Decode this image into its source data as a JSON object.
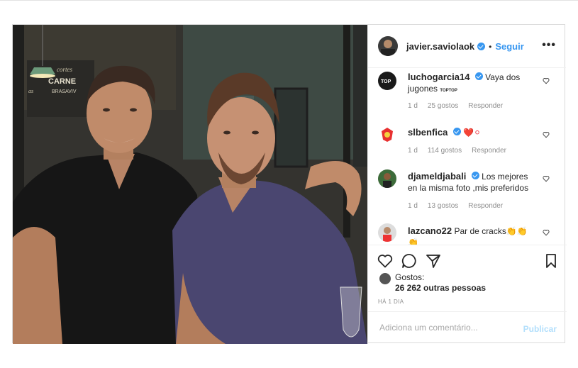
{
  "post": {
    "author": "javier.saviolaok",
    "follow_label": "Seguir",
    "dot": "•",
    "more_label": "•••"
  },
  "photo": {
    "sign_text": "cortes CARNE BRASAVIV"
  },
  "comments": [
    {
      "username": "luchogarcia14",
      "verified": true,
      "text": "Vaya dos jugones",
      "extra": "TOPTOP",
      "age": "1 d",
      "likes": "25 gostos",
      "reply": "Responder"
    },
    {
      "username": "slbenfica",
      "verified": true,
      "text": "❤️⚪",
      "age": "1 d",
      "likes": "114 gostos",
      "reply": "Responder"
    },
    {
      "username": "djameldjabali",
      "verified": true,
      "text": "Los mejores en la misma foto ,mis preferidos",
      "age": "1 d",
      "likes": "13 gostos",
      "reply": "Responder"
    },
    {
      "username": "lazcano22",
      "verified": false,
      "text": "Par de cracks👏👏👏",
      "age": "",
      "likes": "",
      "reply": ""
    }
  ],
  "likes": {
    "label": "Gostos:",
    "count": "26 262 outras pessoas"
  },
  "time_ago": "HÁ 1 DIA",
  "add_comment": {
    "placeholder": "Adiciona um comentário...",
    "publish_label": "Publicar"
  },
  "colors": {
    "accent": "#3897f0",
    "publish_disabled": "#b2dffc",
    "muted": "#8e8e8e"
  },
  "icons": [
    "heart-icon",
    "comment-icon",
    "share-icon",
    "bookmark-icon",
    "verified-icon",
    "more-icon"
  ]
}
